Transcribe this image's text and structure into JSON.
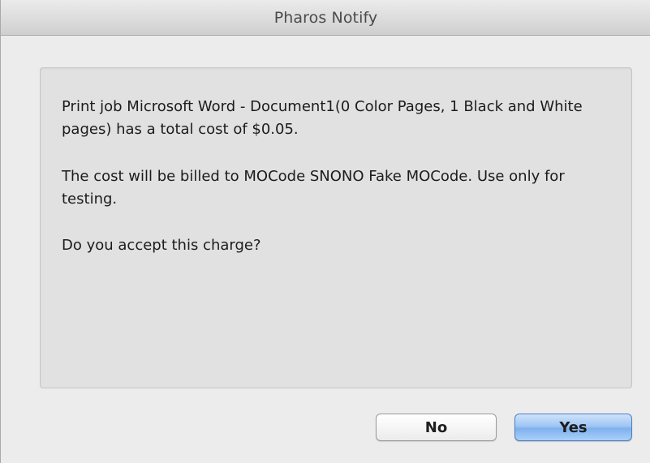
{
  "window": {
    "title": "Pharos Notify"
  },
  "message": {
    "line1": "Print job Microsoft Word - Document1(0 Color Pages, 1 Black and White pages) has a total cost of $0.05.",
    "line2": "The cost will be billed to MOCode SNONO Fake MOCode.  Use only for testing.",
    "line3": "Do you accept this charge?"
  },
  "buttons": {
    "no_label": "No",
    "yes_label": "Yes"
  },
  "colors": {
    "window_background": "#ececec",
    "message_background": "#e1e1e1",
    "default_button_accent": "#7fb1ee"
  }
}
